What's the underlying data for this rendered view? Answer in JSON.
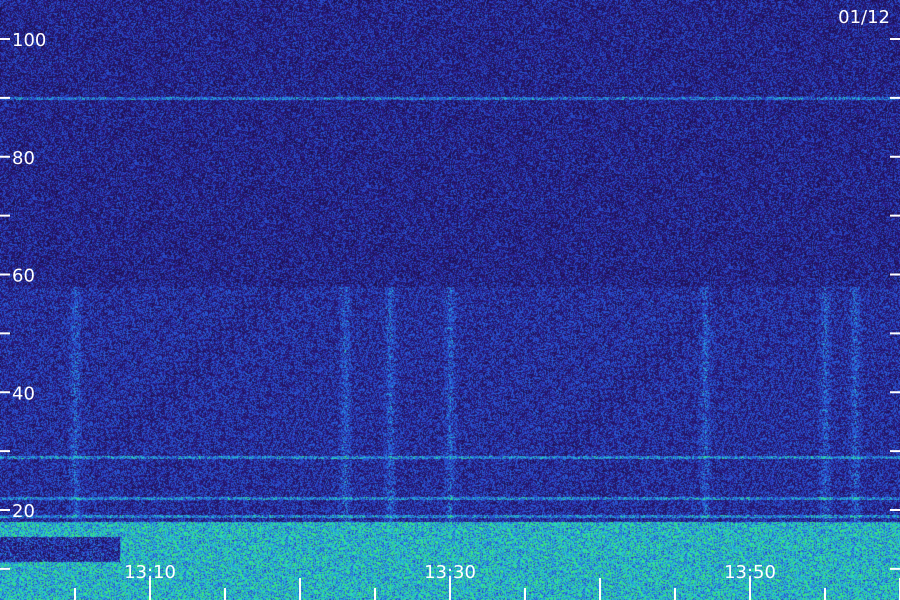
{
  "chart_data": {
    "type": "heatmap",
    "title": "",
    "date_label": "01/12",
    "xlabel": "",
    "ylabel": "",
    "ylim": [
      0,
      102
    ],
    "y_ticks": [
      100,
      80,
      60,
      40,
      20
    ],
    "y_ticks_minor": [
      90,
      70,
      50,
      30,
      10
    ],
    "x_ticks": [
      "13:10",
      "13:30",
      "13:50"
    ],
    "colors": {
      "background": "#2a1a7a",
      "mid": "#3040c8",
      "high": "#30d0e0",
      "peak": "#40e070"
    },
    "features": {
      "horizontal_lines": [
        90,
        29,
        22,
        19
      ],
      "noise_floor_band_top": 18,
      "vertical_streak_times": [
        "13:05",
        "13:23",
        "13:26",
        "13:30",
        "13:47",
        "13:55",
        "13:57"
      ]
    }
  }
}
